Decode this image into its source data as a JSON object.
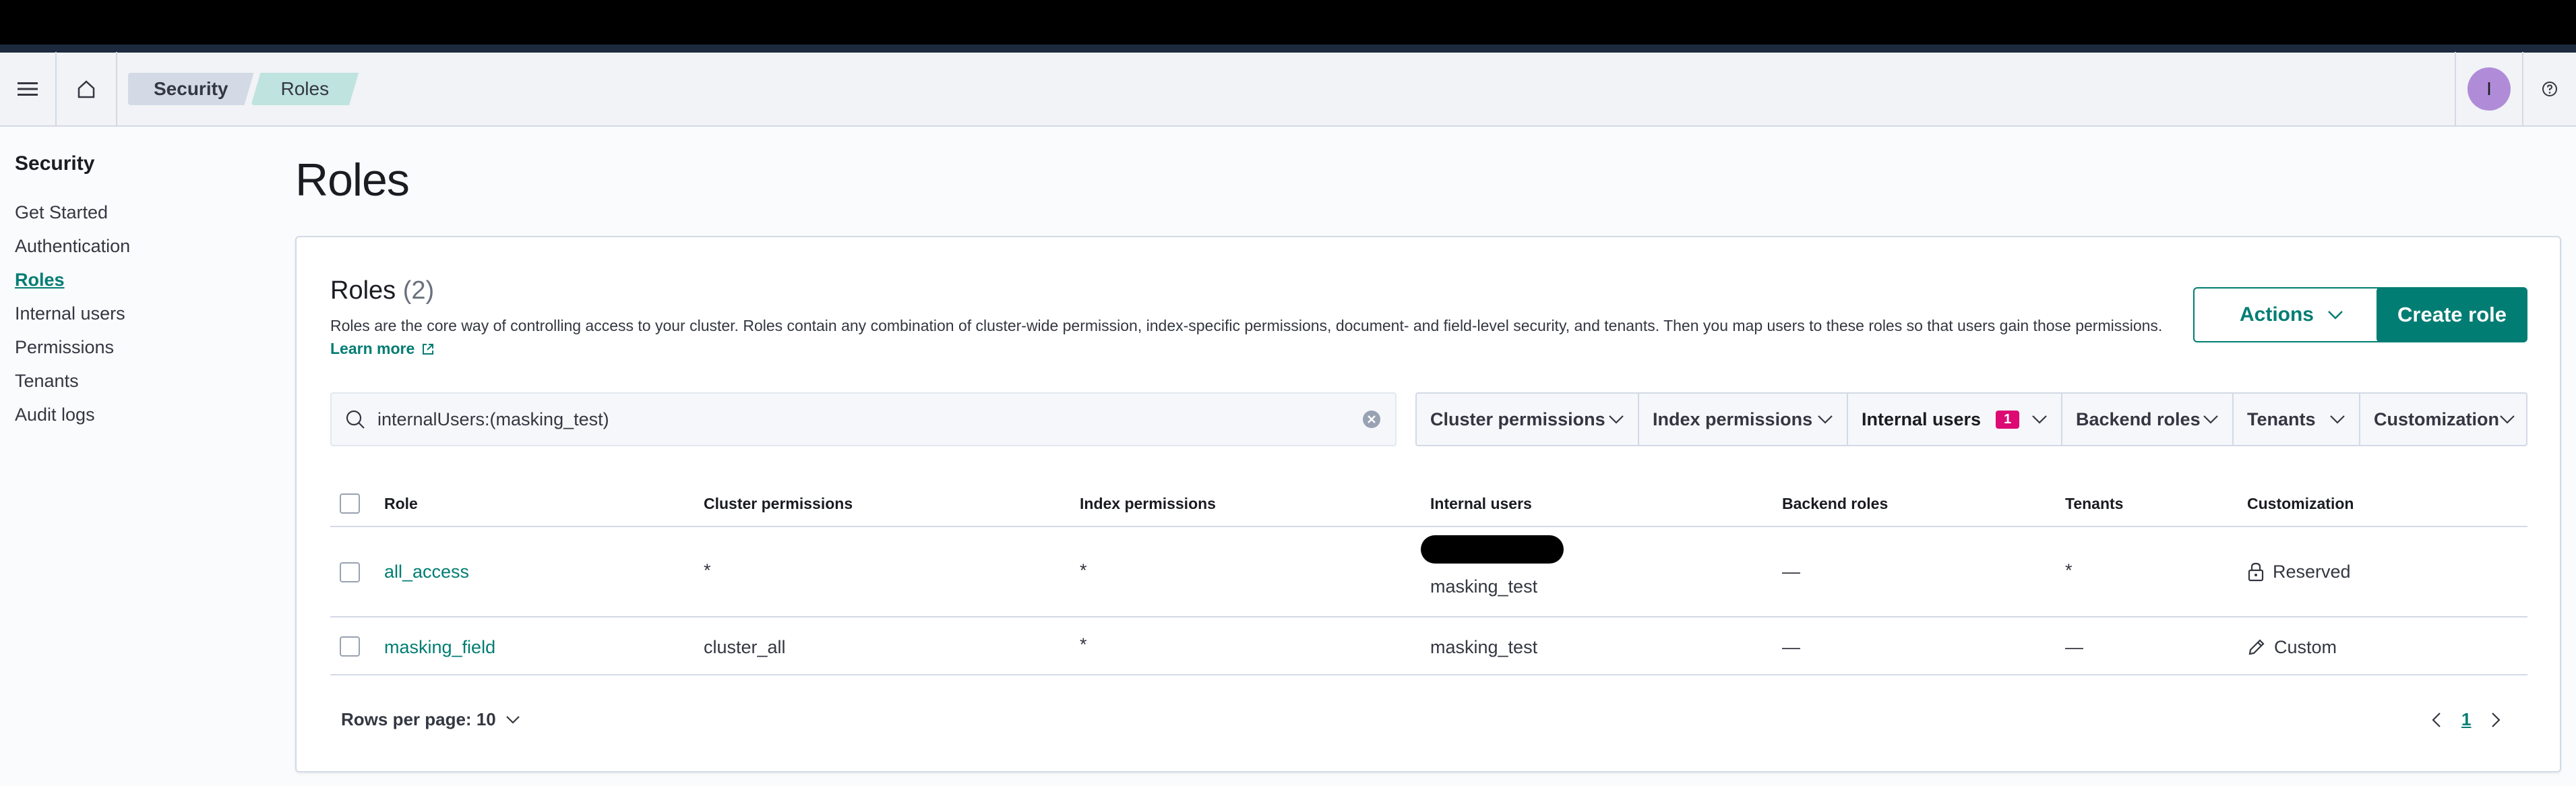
{
  "header": {
    "breadcrumbs": [
      "Security",
      "Roles"
    ],
    "avatar_initial": "I"
  },
  "sidebar": {
    "title": "Security",
    "items": [
      {
        "label": "Get Started",
        "active": false
      },
      {
        "label": "Authentication",
        "active": false
      },
      {
        "label": "Roles",
        "active": true
      },
      {
        "label": "Internal users",
        "active": false
      },
      {
        "label": "Permissions",
        "active": false
      },
      {
        "label": "Tenants",
        "active": false
      },
      {
        "label": "Audit logs",
        "active": false
      }
    ]
  },
  "page": {
    "title": "Roles"
  },
  "panel": {
    "title": "Roles",
    "count": "(2)",
    "description": "Roles are the core way of controlling access to your cluster. Roles contain any combination of cluster-wide permission, index-specific permissions, document- and field-level security, and tenants. Then you map users to these roles so that users gain those permissions.",
    "learn_more": "Learn more",
    "actions_label": "Actions",
    "create_label": "Create role"
  },
  "search": {
    "value": "internalUsers:(masking_test)"
  },
  "filters": [
    {
      "label": "Cluster permissions"
    },
    {
      "label": "Index permissions"
    },
    {
      "label": "Internal users",
      "badge": "1"
    },
    {
      "label": "Backend roles"
    },
    {
      "label": "Tenants"
    },
    {
      "label": "Customization"
    }
  ],
  "table": {
    "columns": [
      "Role",
      "Cluster permissions",
      "Index permissions",
      "Internal users",
      "Backend roles",
      "Tenants",
      "Customization"
    ],
    "rows": [
      {
        "role": "all_access",
        "cluster": "*",
        "index": "*",
        "users": "masking_test",
        "backend": "—",
        "tenants": "*",
        "customization": "Reserved",
        "customization_icon": "lock-icon"
      },
      {
        "role": "masking_field",
        "cluster": "cluster_all",
        "index": "*",
        "users": "masking_test",
        "backend": "—",
        "tenants": "—",
        "customization": "Custom",
        "customization_icon": "pencil-icon"
      }
    ]
  },
  "pagination": {
    "rows_per_page": "Rows per page: 10",
    "current_page": "1"
  },
  "colors": {
    "accent": "#017d73",
    "badge": "#dd0a73",
    "avatar": "#b08cd8"
  }
}
